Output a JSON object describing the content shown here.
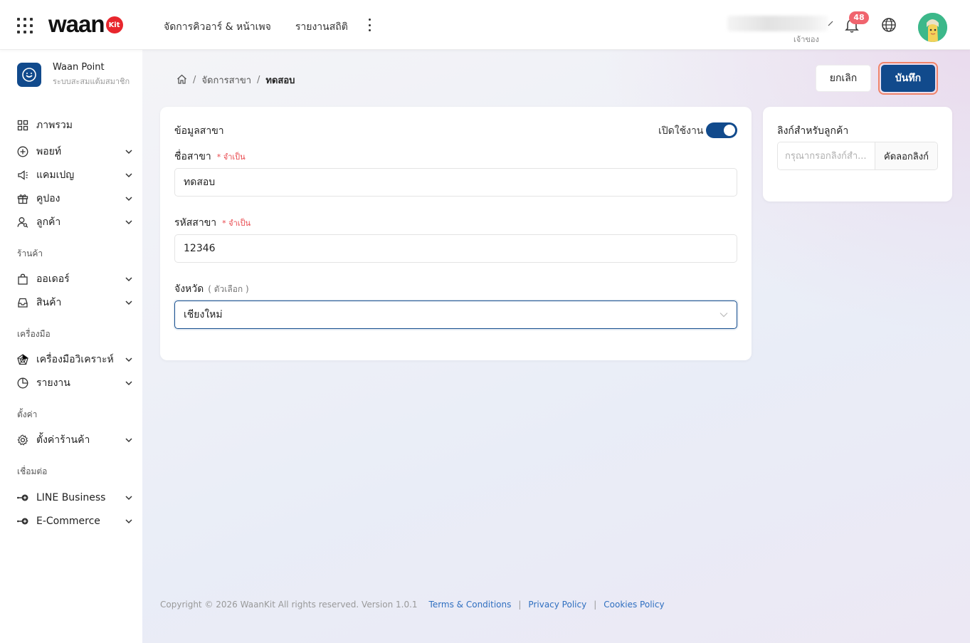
{
  "header": {
    "logo_text": "waan",
    "logo_badge": "Kit",
    "nav": [
      "จัดการคิวอาร์ & หน้าเพจ",
      "รายงานสถิติ"
    ],
    "user_role": "เจ้าของ",
    "notification_count": "48"
  },
  "sidebar": {
    "brand_name": "Waan Point",
    "brand_sub": "ระบบสะสมแต้มสมาชิก",
    "items": {
      "overview": "ภาพรวม",
      "points": "พอยท์",
      "campaign": "แคมเปญ",
      "coupon": "คูปอง",
      "customer": "ลูกค้า",
      "orders": "ออเดอร์",
      "products": "สินค้า",
      "analytics": "เครื่องมือวิเคราะห์",
      "reports": "รายงาน",
      "store_settings": "ตั้งค่าร้านค้า",
      "line_business": "LINE Business",
      "ecommerce": "E-Commerce"
    },
    "sections": {
      "store": "ร้านค้า",
      "tools": "เครื่องมือ",
      "settings": "ตั้งค่า",
      "connect": "เชื่อมต่อ"
    }
  },
  "breadcrumb": {
    "items": [
      "จัดการสาขา",
      "ทดสอบ"
    ]
  },
  "actions": {
    "cancel": "ยกเลิก",
    "save": "บันทึก"
  },
  "branch_form": {
    "title": "ข้อมูลสาขา",
    "toggle_label": "เปิดใช้งาน",
    "toggle_on": true,
    "name_label": "ชื่อสาขา",
    "required_text": "* จำเป็น",
    "name_value": "ทดสอบ",
    "code_label": "รหัสสาขา",
    "code_value": "12346",
    "province_label": "จังหวัด",
    "optional_text": "( ตัวเลือก )",
    "province_value": "เชียงใหม่"
  },
  "customer_link": {
    "title": "ลิงก์สำหรับลูกค้า",
    "placeholder": "กรุณากรอกลิงก์สำ...",
    "copy_button": "คัดลอกลิงก์"
  },
  "footer": {
    "copyright": "Copyright © 2026 WaanKit All rights reserved. Version 1.0.1",
    "links": [
      "Terms & Conditions",
      "Privacy Policy",
      "Cookies Policy"
    ],
    "separator": "|"
  }
}
